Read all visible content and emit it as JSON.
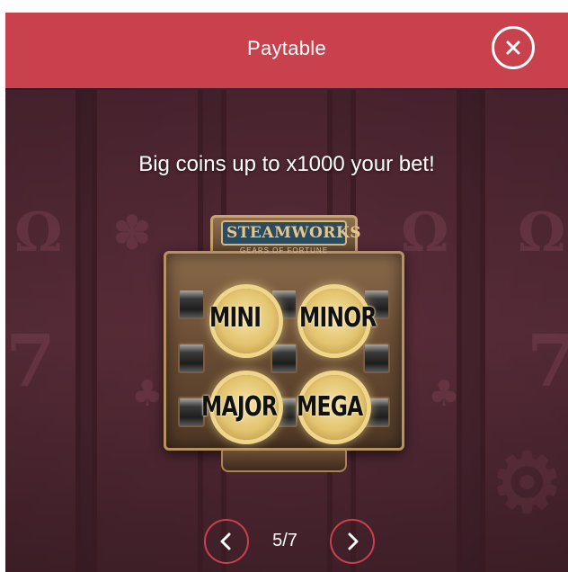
{
  "header": {
    "title": "Paytable",
    "close_icon": "close-icon"
  },
  "content": {
    "headline": "Big coins up to x1000 your bet!",
    "logo": {
      "title": "STEAMWORKS",
      "subtitle": "GEARS OF FORTUNE"
    },
    "coins": [
      "MINI",
      "MINOR",
      "MAJOR",
      "MEGA"
    ]
  },
  "pager": {
    "current": 5,
    "total": 7,
    "label": "5/7",
    "prev_icon": "chevron-left-icon",
    "next_icon": "chevron-right-icon"
  },
  "colors": {
    "accent": "#c8414d",
    "background": "#40202a",
    "text": "#ffffff",
    "coin_gold": "#e3c46f"
  }
}
